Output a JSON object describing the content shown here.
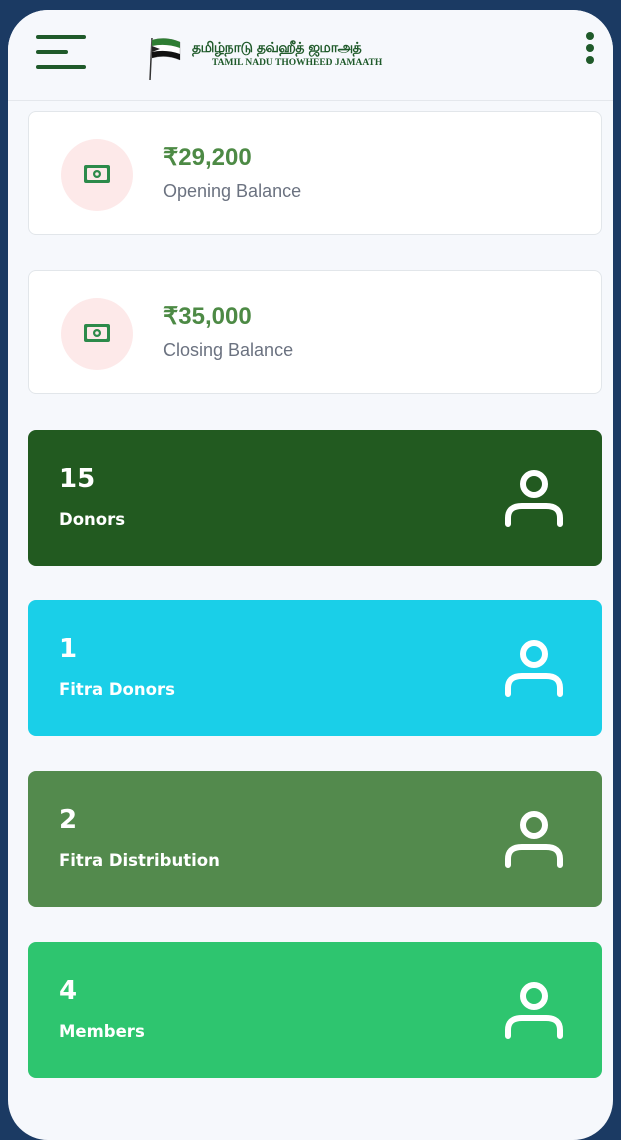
{
  "header": {
    "logo_tamil": "தமிழ்நாடு தவ்ஹீத் ஜமாஅத்",
    "logo_english": "TAMIL NADU THOWHEED JAMAATH",
    "icons": {
      "menu": "menu-icon",
      "more": "more-vertical-icon",
      "logo": "flag-logo"
    }
  },
  "balances": [
    {
      "amount": "₹29,200",
      "label": "Opening Balance",
      "icon": "cash-icon"
    },
    {
      "amount": "₹35,000",
      "label": "Closing Balance",
      "icon": "cash-icon"
    }
  ],
  "stats": [
    {
      "count": "15",
      "label": "Donors",
      "color": "#225a20",
      "icon": "user-icon"
    },
    {
      "count": "1",
      "label": "Fitra Donors",
      "color": "#1acfe8",
      "icon": "user-icon"
    },
    {
      "count": "2",
      "label": "Fitra Distribution",
      "color": "#538a4d",
      "icon": "user-icon"
    },
    {
      "count": "4",
      "label": "Members",
      "color": "#2ec56f",
      "icon": "user-icon"
    }
  ],
  "colors": {
    "background": "#1b3a63",
    "screen": "#f6f8fc",
    "brand_green": "#1f5a2a",
    "amount_green": "#4d8a45",
    "icon_circle": "#fde9e9"
  }
}
